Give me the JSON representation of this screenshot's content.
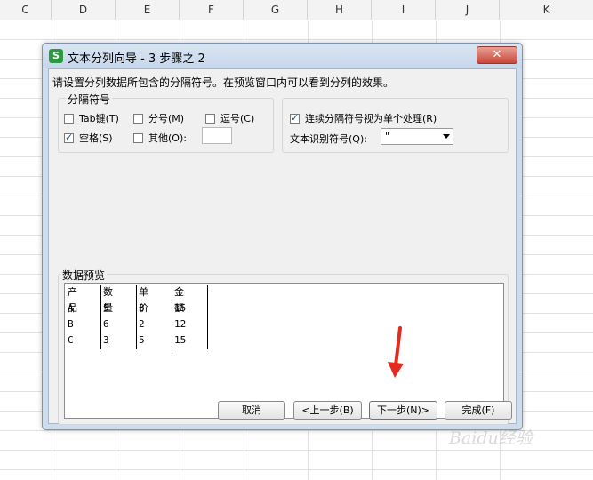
{
  "spreadsheet": {
    "columns": [
      "C",
      "D",
      "E",
      "F",
      "G",
      "H",
      "I",
      "J",
      "K"
    ]
  },
  "dialog": {
    "title": "文本分列向导 - 3 步骤之 2",
    "app_icon": "S",
    "close_label": "✕",
    "instruction": "请设置分列数据所包含的分隔符号。在预览窗口内可以看到分列的效果。",
    "delimiters": {
      "group_label": "分隔符号",
      "options": [
        {
          "label": "Tab键(T)",
          "checked": false
        },
        {
          "label": "分号(M)",
          "checked": false
        },
        {
          "label": "逗号(C)",
          "checked": false
        },
        {
          "label": "空格(S)",
          "checked": true
        },
        {
          "label": "其他(O):",
          "checked": false
        }
      ],
      "other_value": ""
    },
    "consecutive": {
      "label": "连续分隔符号视为单个处理(R)",
      "checked": true
    },
    "text_qualifier": {
      "label": "文本识别符号(Q):",
      "value": "\""
    },
    "preview": {
      "label": "数据预览",
      "rows": [
        [
          "产品",
          "数量",
          "单价",
          "金额"
        ],
        [
          "A",
          "5",
          "3",
          "15"
        ],
        [
          "B",
          "6",
          "2",
          "12"
        ],
        [
          "C",
          "3",
          "5",
          "15"
        ]
      ]
    },
    "buttons": {
      "cancel": "取消",
      "back": "<上一步(B)",
      "next": "下一步(N)>",
      "finish": "完成(F)"
    }
  },
  "watermark": "Baidu经验"
}
